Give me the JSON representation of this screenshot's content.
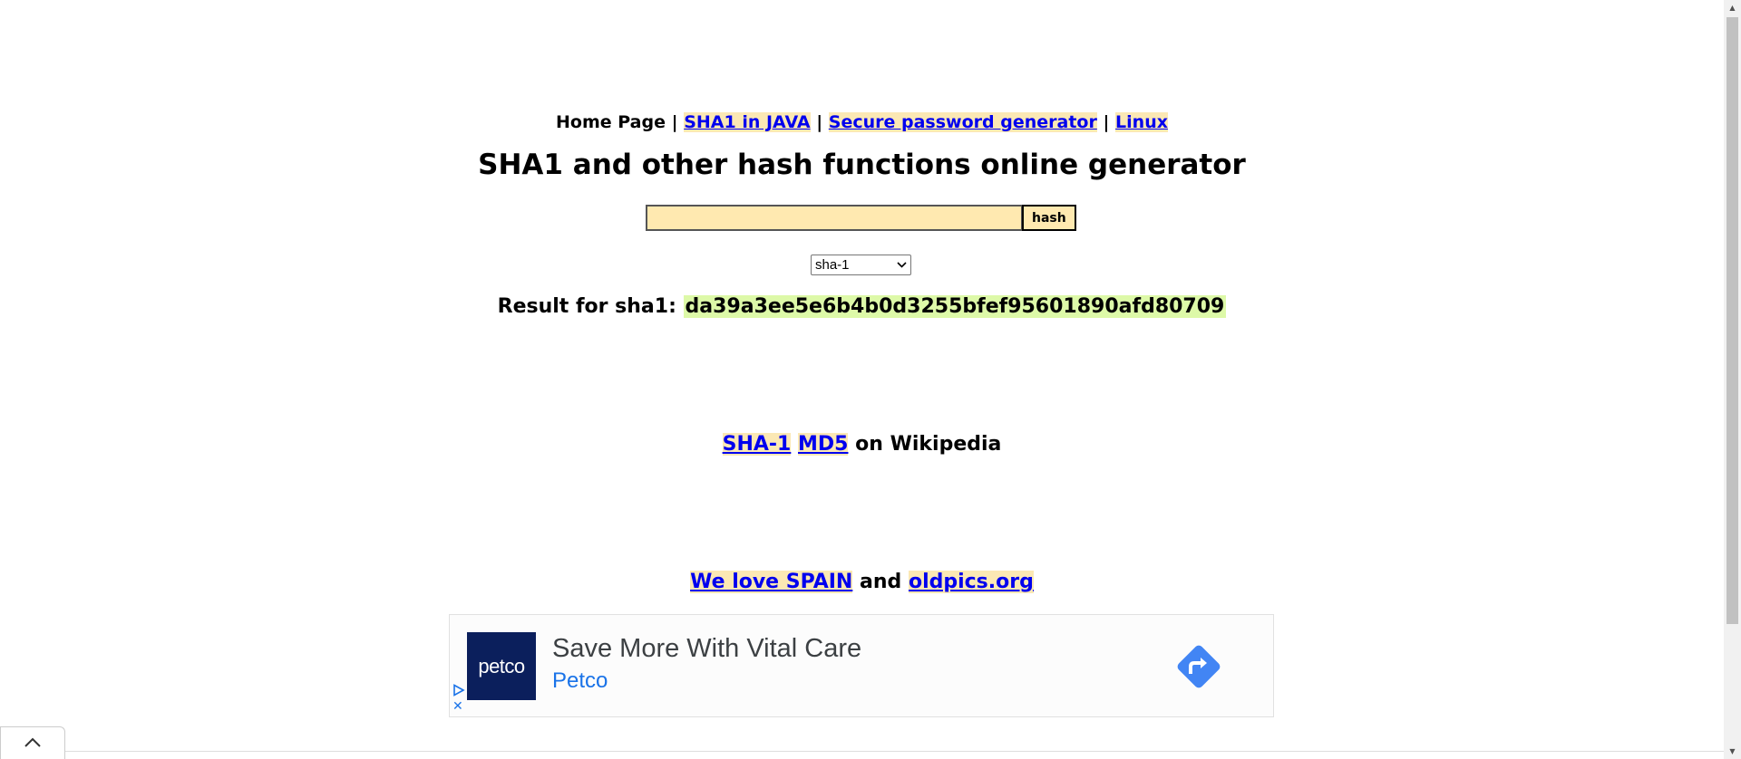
{
  "nav": {
    "home": "Home Page",
    "separator": "|",
    "items": [
      {
        "label": "SHA1 in JAVA"
      },
      {
        "label": "Secure password generator"
      },
      {
        "label": "Linux"
      }
    ]
  },
  "title": "SHA1 and other hash functions online generator",
  "form": {
    "input_value": "",
    "button_label": "hash",
    "selected_algorithm": "sha-1"
  },
  "result": {
    "label": "Result for sha1:",
    "value": "da39a3ee5e6b4b0d3255bfef95601890afd80709"
  },
  "wiki": {
    "link1": "SHA-1",
    "link2": "MD5",
    "suffix": "on Wikipedia"
  },
  "promo": {
    "link1": "We love SPAIN",
    "middle": "and",
    "link2": "oldpics.org"
  },
  "ad": {
    "logo_text": "petco",
    "headline": "Save More With Vital Care",
    "advertiser": "Petco",
    "close_glyph": "✕"
  },
  "icons": {
    "scroll_up": "chevron-up-icon",
    "cta": "directions-arrow-icon"
  },
  "colors": {
    "link": "#0000ee",
    "link_highlight": "#fbe8b4",
    "result_highlight": "#ddf9a8",
    "input_bg": "#ffe9b0",
    "ad_blue": "#1a73e8",
    "petco_navy": "#0b1f5c"
  }
}
